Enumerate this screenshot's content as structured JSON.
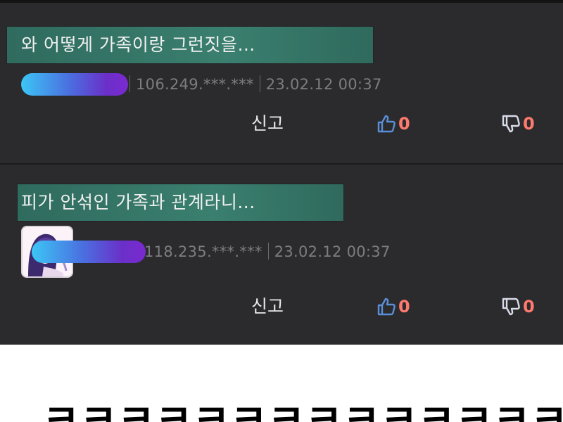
{
  "comments": [
    {
      "text": "와 어떻게 가족이랑 그런짓을…",
      "ip": "106.249.***.***",
      "date": "23.02.12 00:37",
      "report_label": "신고",
      "upvotes": "0",
      "downvotes": "0",
      "has_avatar": false
    },
    {
      "text": "피가 안섞인 가족과 관계라니...",
      "ip": "118.235.***.***",
      "date": "23.02.12 00:37",
      "report_label": "신고",
      "upvotes": "0",
      "downvotes": "0",
      "has_avatar": true
    }
  ],
  "reaction": {
    "text": "ㅋㅋㅋㅋㅋㅋㅋㅋㅋㅋㅋㅋㅋㅋ"
  },
  "colors": {
    "panel_bg": "#2b2b2d",
    "highlight": "#3a7f6f",
    "vote_count": "#ff7a6e",
    "thumb_up": "#5a8fd8",
    "thumb_down": "#d8dbe8",
    "redaction_start": "#3cc6f5",
    "redaction_end": "#7a2ad0"
  },
  "icons": {
    "upvote": "thumbs-up-outline",
    "downvote": "thumbs-down-outline"
  }
}
